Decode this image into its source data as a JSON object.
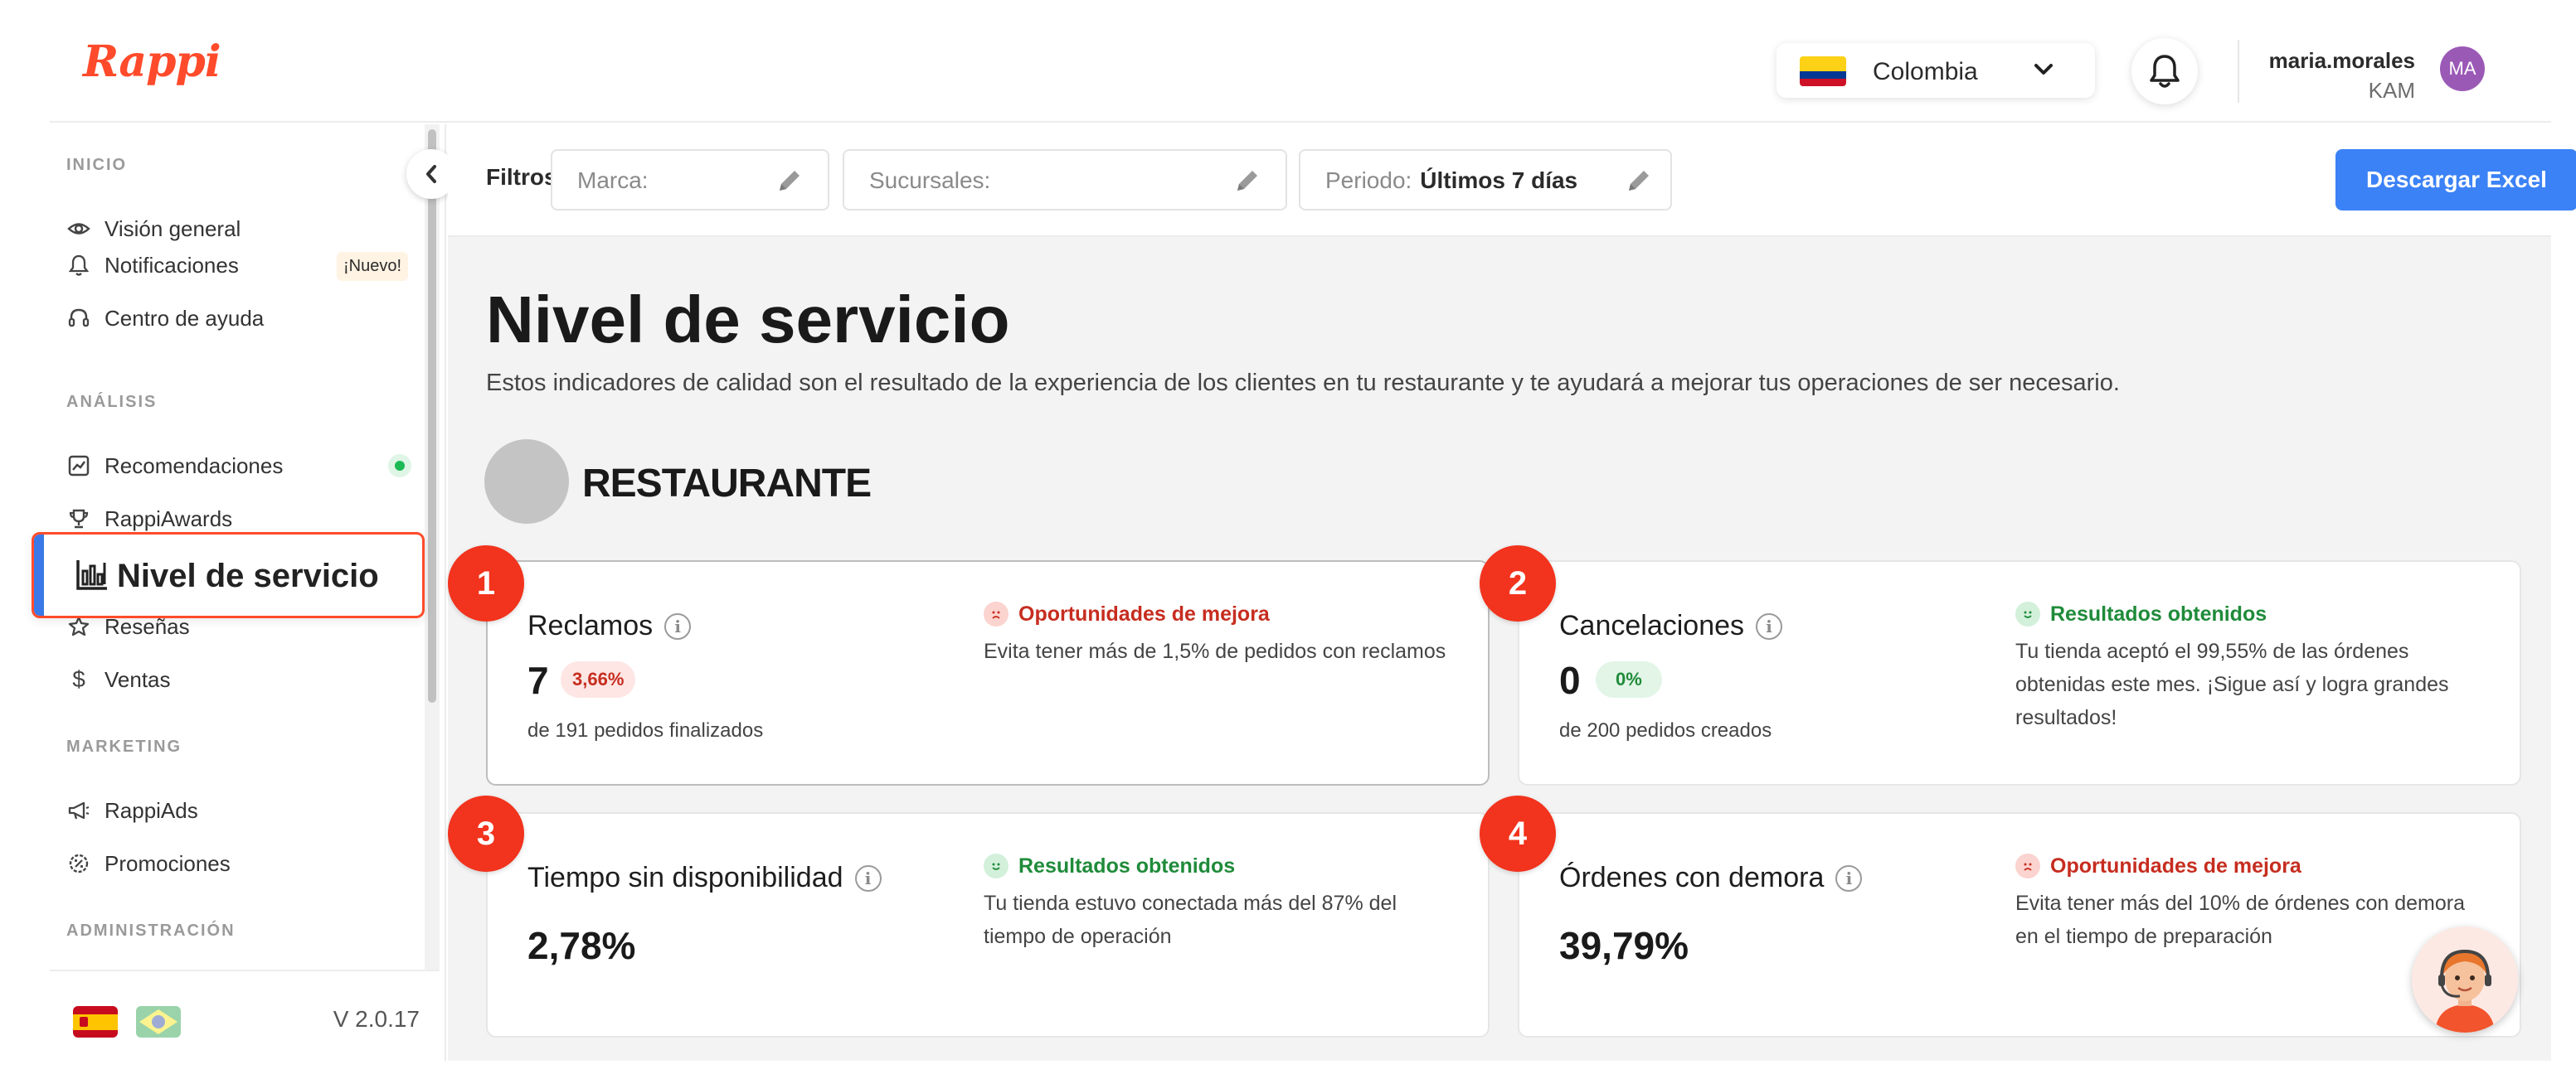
{
  "header": {
    "logo": "Rappi",
    "country": "Colombia",
    "user_name": "maria.morales",
    "user_role": "KAM",
    "avatar_initials": "MA"
  },
  "sidebar": {
    "sections": [
      {
        "label": "INICIO"
      },
      {
        "label": "ANÁLISIS"
      },
      {
        "label": "MARKETING"
      },
      {
        "label": "ADMINISTRACIÓN"
      }
    ],
    "items": {
      "vision": "Visión general",
      "notificaciones": "Notificaciones",
      "nuevo_badge": "¡Nuevo!",
      "ayuda": "Centro de ayuda",
      "recomendaciones": "Recomendaciones",
      "awards": "RappiAwards",
      "nivel": "Nivel de servicio",
      "resenas": "Reseñas",
      "ventas": "Ventas",
      "ads": "RappiAds",
      "promociones": "Promociones"
    },
    "version": "V 2.0.17"
  },
  "filters": {
    "label": "Filtros",
    "marca": "Marca:",
    "sucursales": "Sucursales:",
    "periodo_label": "Periodo:",
    "periodo_value": "Últimos 7 días",
    "download": "Descargar Excel"
  },
  "page": {
    "title": "Nivel de servicio",
    "description": "Estos indicadores de calidad son el resultado de la experiencia de los clientes en tu restaurante y te ayudará a mejorar tus operaciones de ser necesario.",
    "restaurant": "RESTAURANTE"
  },
  "cards": [
    {
      "marker": "1",
      "title": "Reclamos",
      "value": "7",
      "pill": "3,66%",
      "sub": "de 191 pedidos finalizados",
      "status": "Oportunidades de mejora",
      "desc": "Evita tener más de 1,5% de pedidos con reclamos"
    },
    {
      "marker": "2",
      "title": "Cancelaciones",
      "value": "0",
      "pill": "0%",
      "sub": "de 200 pedidos creados",
      "status": "Resultados obtenidos",
      "desc": "Tu tienda aceptó el 99,55% de las órdenes obtenidas este mes. ¡Sigue así y logra grandes resultados!"
    },
    {
      "marker": "3",
      "title": "Tiempo sin disponibilidad",
      "value": "2,78%",
      "status": "Resultados obtenidos",
      "desc": "Tu tienda estuvo conectada más del 87% del tiempo de operación"
    },
    {
      "marker": "4",
      "title": "Órdenes con demora",
      "value": "39,79%",
      "status": "Oportunidades de mejora",
      "desc": "Evita tener más del 10% de órdenes con demora en el tiempo de preparación"
    }
  ],
  "colors": {
    "brand": "#ff4b2b",
    "primary_button": "#3b82f6",
    "marker": "#f2331d",
    "good": "#1f8b3a",
    "bad": "#c62d1f"
  }
}
